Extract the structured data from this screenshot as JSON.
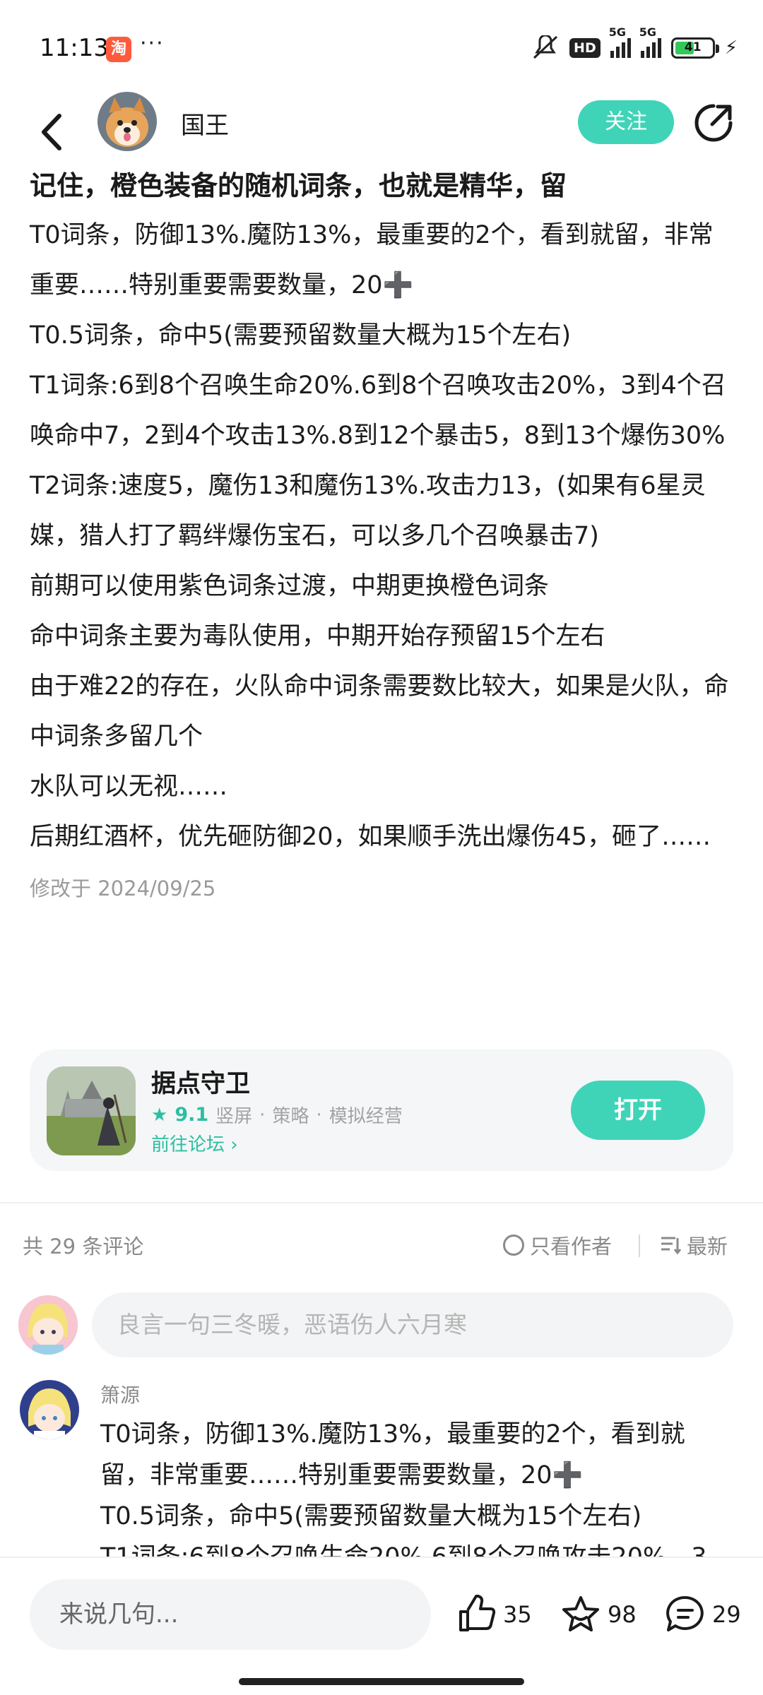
{
  "status_bar": {
    "time": "11:13",
    "app_badge": "淘",
    "more": "···",
    "hd_label": "HD",
    "signal_1_label": "5G",
    "signal_2_label": "5G",
    "battery": "41"
  },
  "header": {
    "author_name": "国王",
    "follow_label": "关注"
  },
  "post": {
    "title": "记住，橙色装备的随机词条，也就是精华，留",
    "paragraphs": [
      "T0词条，防御13%.魔防13%，最重要的2个，看到就留，非常重要……特别重要需要数量，20➕",
      "T0.5词条，命中5(需要预留数量大概为15个左右)",
      "T1词条:6到8个召唤生命20%.6到8个召唤攻击20%，3到4个召唤命中7，2到4个攻击13%.8到12个暴击5，8到13个爆伤30%",
      "T2词条:速度5，魔伤13和魔伤13%.攻击力13，(如果有6星灵媒，猎人打了羁绊爆伤宝石，可以多几个召唤暴击7)",
      "前期可以使用紫色词条过渡，中期更换橙色词条",
      "命中词条主要为毒队使用，中期开始存预留15个左右",
      "由于难22的存在，火队命中词条需要数比较大，如果是火队，命中词条多留几个",
      "水队可以无视……",
      "后期红酒杯，优先砸防御20，如果顺手洗出爆伤45，砸了……"
    ],
    "modified": "修改于 2024/09/25"
  },
  "game_card": {
    "name": "据点守卫",
    "score": "9.1",
    "tags": [
      "竖屏",
      "策略",
      "模拟经营"
    ],
    "separator": "·",
    "forum_link": "前往论坛",
    "open_label": "打开"
  },
  "comments": {
    "count_label": "共 29 条评论",
    "only_author_label": "只看作者",
    "sort_label": "最新",
    "compose_placeholder": "良言一句三冬暖，恶语伤人六月寒",
    "reply": {
      "name": "箫源",
      "lines": [
        "T0词条，防御13%.魔防13%，最重要的2个，看到就留，非常重要……特别重要需要数量，20➕",
        "T0.5词条，命中5(需要预留数量大概为15个左右)",
        "T1词条:6到8个召唤生命20%.6到8个召唤攻击20%，3"
      ]
    }
  },
  "bottom_bar": {
    "say_placeholder": "来说几句...",
    "likes": "35",
    "favorites": "98",
    "comments": "29"
  },
  "colors": {
    "accent": "#3fd4b8",
    "accent_text": "#2bbfa2",
    "muted": "#8a8a8a"
  },
  "icons": [
    "back-arrow-icon",
    "share-icon",
    "star-icon",
    "chevron-right-icon",
    "circle-icon",
    "sort-lines-icon",
    "thumbs-up-icon",
    "star-outline-icon",
    "chat-bubble-icon"
  ]
}
